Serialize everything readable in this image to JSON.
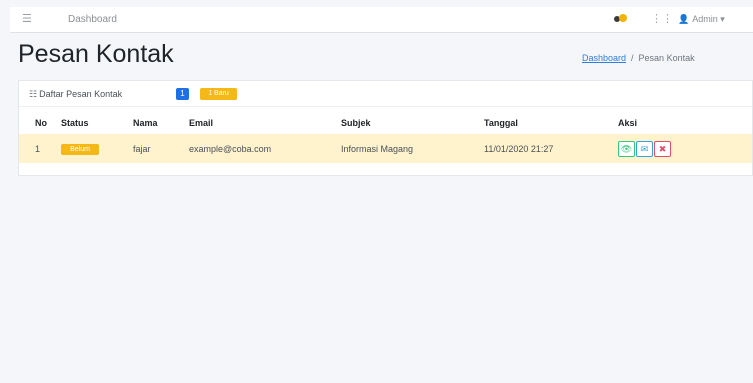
{
  "navbar": {
    "menu_icon": "☰",
    "home_link": "Dashboard",
    "grid_icon": "⋮⋮",
    "user_icon": "👤",
    "user_label": "Admin ▾"
  },
  "page": {
    "title": "Pesan Kontak"
  },
  "breadcrumb": {
    "home": "Dashboard",
    "separator": "/",
    "current": "Pesan Kontak"
  },
  "card": {
    "list_icon": "☷",
    "title": "Daftar Pesan Kontak",
    "count_badge": "1",
    "new_badge": "1 Baru"
  },
  "table": {
    "headers": {
      "no": "No",
      "status": "Status",
      "nama": "Nama",
      "email": "Email",
      "subjek": "Subjek",
      "tanggal": "Tanggal",
      "aksi": "Aksi"
    },
    "rows": [
      {
        "no": "1",
        "status": "Belum",
        "nama": "fajar",
        "email": "example@coba.com",
        "subjek": "Informasi Magang",
        "tanggal": "11/01/2020 21:27",
        "actions": {
          "view": "👁",
          "mail": "✉",
          "delete": "✖"
        }
      }
    ]
  },
  "colors": {
    "primary": "#1f6fe5",
    "warning": "#f4b818",
    "row_highlight": "#fff3cd",
    "success": "#34c77b",
    "info": "#34a5d6",
    "danger": "#e0506a",
    "link": "#2f7ed8"
  }
}
